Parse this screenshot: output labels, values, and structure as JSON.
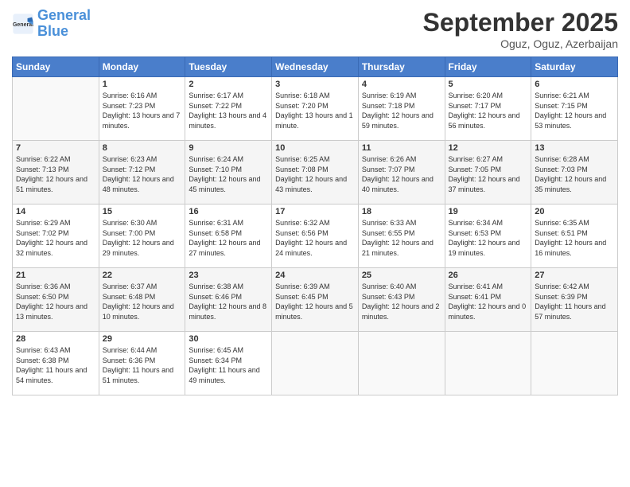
{
  "header": {
    "logo_general": "General",
    "logo_blue": "Blue",
    "month_year": "September 2025",
    "location": "Oguz, Oguz, Azerbaijan"
  },
  "days_of_week": [
    "Sunday",
    "Monday",
    "Tuesday",
    "Wednesday",
    "Thursday",
    "Friday",
    "Saturday"
  ],
  "weeks": [
    [
      {
        "day": "",
        "sunrise": "",
        "sunset": "",
        "daylight": "",
        "empty": true
      },
      {
        "day": "1",
        "sunrise": "Sunrise: 6:16 AM",
        "sunset": "Sunset: 7:23 PM",
        "daylight": "Daylight: 13 hours and 7 minutes."
      },
      {
        "day": "2",
        "sunrise": "Sunrise: 6:17 AM",
        "sunset": "Sunset: 7:22 PM",
        "daylight": "Daylight: 13 hours and 4 minutes."
      },
      {
        "day": "3",
        "sunrise": "Sunrise: 6:18 AM",
        "sunset": "Sunset: 7:20 PM",
        "daylight": "Daylight: 13 hours and 1 minute."
      },
      {
        "day": "4",
        "sunrise": "Sunrise: 6:19 AM",
        "sunset": "Sunset: 7:18 PM",
        "daylight": "Daylight: 12 hours and 59 minutes."
      },
      {
        "day": "5",
        "sunrise": "Sunrise: 6:20 AM",
        "sunset": "Sunset: 7:17 PM",
        "daylight": "Daylight: 12 hours and 56 minutes."
      },
      {
        "day": "6",
        "sunrise": "Sunrise: 6:21 AM",
        "sunset": "Sunset: 7:15 PM",
        "daylight": "Daylight: 12 hours and 53 minutes."
      }
    ],
    [
      {
        "day": "7",
        "sunrise": "Sunrise: 6:22 AM",
        "sunset": "Sunset: 7:13 PM",
        "daylight": "Daylight: 12 hours and 51 minutes."
      },
      {
        "day": "8",
        "sunrise": "Sunrise: 6:23 AM",
        "sunset": "Sunset: 7:12 PM",
        "daylight": "Daylight: 12 hours and 48 minutes."
      },
      {
        "day": "9",
        "sunrise": "Sunrise: 6:24 AM",
        "sunset": "Sunset: 7:10 PM",
        "daylight": "Daylight: 12 hours and 45 minutes."
      },
      {
        "day": "10",
        "sunrise": "Sunrise: 6:25 AM",
        "sunset": "Sunset: 7:08 PM",
        "daylight": "Daylight: 12 hours and 43 minutes."
      },
      {
        "day": "11",
        "sunrise": "Sunrise: 6:26 AM",
        "sunset": "Sunset: 7:07 PM",
        "daylight": "Daylight: 12 hours and 40 minutes."
      },
      {
        "day": "12",
        "sunrise": "Sunrise: 6:27 AM",
        "sunset": "Sunset: 7:05 PM",
        "daylight": "Daylight: 12 hours and 37 minutes."
      },
      {
        "day": "13",
        "sunrise": "Sunrise: 6:28 AM",
        "sunset": "Sunset: 7:03 PM",
        "daylight": "Daylight: 12 hours and 35 minutes."
      }
    ],
    [
      {
        "day": "14",
        "sunrise": "Sunrise: 6:29 AM",
        "sunset": "Sunset: 7:02 PM",
        "daylight": "Daylight: 12 hours and 32 minutes."
      },
      {
        "day": "15",
        "sunrise": "Sunrise: 6:30 AM",
        "sunset": "Sunset: 7:00 PM",
        "daylight": "Daylight: 12 hours and 29 minutes."
      },
      {
        "day": "16",
        "sunrise": "Sunrise: 6:31 AM",
        "sunset": "Sunset: 6:58 PM",
        "daylight": "Daylight: 12 hours and 27 minutes."
      },
      {
        "day": "17",
        "sunrise": "Sunrise: 6:32 AM",
        "sunset": "Sunset: 6:56 PM",
        "daylight": "Daylight: 12 hours and 24 minutes."
      },
      {
        "day": "18",
        "sunrise": "Sunrise: 6:33 AM",
        "sunset": "Sunset: 6:55 PM",
        "daylight": "Daylight: 12 hours and 21 minutes."
      },
      {
        "day": "19",
        "sunrise": "Sunrise: 6:34 AM",
        "sunset": "Sunset: 6:53 PM",
        "daylight": "Daylight: 12 hours and 19 minutes."
      },
      {
        "day": "20",
        "sunrise": "Sunrise: 6:35 AM",
        "sunset": "Sunset: 6:51 PM",
        "daylight": "Daylight: 12 hours and 16 minutes."
      }
    ],
    [
      {
        "day": "21",
        "sunrise": "Sunrise: 6:36 AM",
        "sunset": "Sunset: 6:50 PM",
        "daylight": "Daylight: 12 hours and 13 minutes."
      },
      {
        "day": "22",
        "sunrise": "Sunrise: 6:37 AM",
        "sunset": "Sunset: 6:48 PM",
        "daylight": "Daylight: 12 hours and 10 minutes."
      },
      {
        "day": "23",
        "sunrise": "Sunrise: 6:38 AM",
        "sunset": "Sunset: 6:46 PM",
        "daylight": "Daylight: 12 hours and 8 minutes."
      },
      {
        "day": "24",
        "sunrise": "Sunrise: 6:39 AM",
        "sunset": "Sunset: 6:45 PM",
        "daylight": "Daylight: 12 hours and 5 minutes."
      },
      {
        "day": "25",
        "sunrise": "Sunrise: 6:40 AM",
        "sunset": "Sunset: 6:43 PM",
        "daylight": "Daylight: 12 hours and 2 minutes."
      },
      {
        "day": "26",
        "sunrise": "Sunrise: 6:41 AM",
        "sunset": "Sunset: 6:41 PM",
        "daylight": "Daylight: 12 hours and 0 minutes."
      },
      {
        "day": "27",
        "sunrise": "Sunrise: 6:42 AM",
        "sunset": "Sunset: 6:39 PM",
        "daylight": "Daylight: 11 hours and 57 minutes."
      }
    ],
    [
      {
        "day": "28",
        "sunrise": "Sunrise: 6:43 AM",
        "sunset": "Sunset: 6:38 PM",
        "daylight": "Daylight: 11 hours and 54 minutes."
      },
      {
        "day": "29",
        "sunrise": "Sunrise: 6:44 AM",
        "sunset": "Sunset: 6:36 PM",
        "daylight": "Daylight: 11 hours and 51 minutes."
      },
      {
        "day": "30",
        "sunrise": "Sunrise: 6:45 AM",
        "sunset": "Sunset: 6:34 PM",
        "daylight": "Daylight: 11 hours and 49 minutes."
      },
      {
        "day": "",
        "sunrise": "",
        "sunset": "",
        "daylight": "",
        "empty": true
      },
      {
        "day": "",
        "sunrise": "",
        "sunset": "",
        "daylight": "",
        "empty": true
      },
      {
        "day": "",
        "sunrise": "",
        "sunset": "",
        "daylight": "",
        "empty": true
      },
      {
        "day": "",
        "sunrise": "",
        "sunset": "",
        "daylight": "",
        "empty": true
      }
    ]
  ]
}
